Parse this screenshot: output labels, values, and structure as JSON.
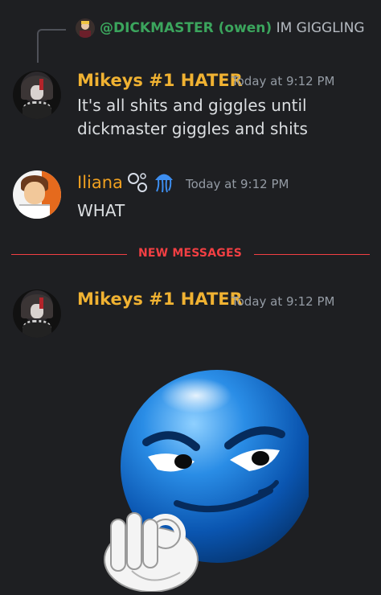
{
  "reply": {
    "mention": "@DICKMASTER (owen)",
    "text": "IM GIGGLING"
  },
  "messages": [
    {
      "author": "Mikeys #1 HATER",
      "timestamp": "Today at 9:12 PM",
      "lines": [
        "It's all shits and giggles until",
        "dickmaster giggles and shits"
      ]
    },
    {
      "author": "Iliana",
      "timestamp": "Today at 9:12 PM",
      "text": "WHAT",
      "badges": [
        "bubbles-icon",
        "jellyfish-icon"
      ]
    },
    {
      "author": "Mikeys #1 HATER",
      "timestamp": "Today at 9:12 PM"
    }
  ],
  "divider": {
    "label": "NEW MESSAGES"
  },
  "colors": {
    "background": "#1e1f22",
    "hater_name": "#f0b232",
    "iliana_name": "#f0a020",
    "mention": "#3ba55d",
    "new_messages": "#f23f43",
    "timestamp": "#949ba4"
  },
  "sticker": {
    "icon": "smirking-blue-emoji-ok-hand-icon"
  }
}
